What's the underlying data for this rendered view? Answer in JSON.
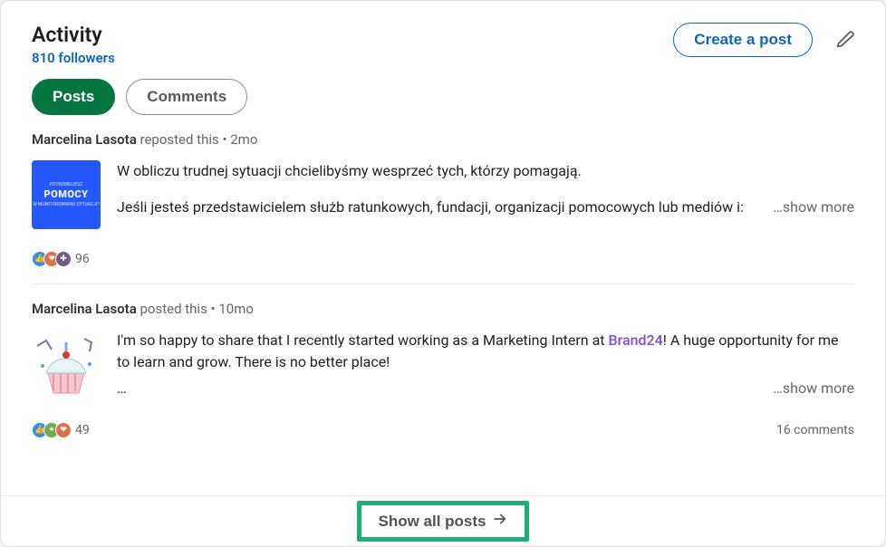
{
  "header": {
    "title": "Activity",
    "followers_text": "810 followers",
    "create_post_label": "Create a post"
  },
  "tabs": {
    "posts": "Posts",
    "comments": "Comments"
  },
  "posts": [
    {
      "author": "Marcelina Lasota",
      "action": "reposted this",
      "time": "2mo",
      "line1": "W obliczu trudnej sytuacji chcielibyśmy wesprzeć tych, którzy pomagają.",
      "line2": "Jeśli jesteś przedstawicielem służb ratunkowych, fundacji, organizacji pomocowych lub mediów i:",
      "show_more": "…show more",
      "reactions_count": "96",
      "thumb_mid": "POMOCY"
    },
    {
      "author": "Marcelina Lasota",
      "action": "posted this",
      "time": "10mo",
      "text_before_brand": "I'm so happy to share that I recently started working as a Marketing Intern at ",
      "brand": "Brand24",
      "text_after_brand": "! A huge opportunity for me to learn and grow. There is no better place!",
      "ellipsis": "…",
      "show_more": "…show more",
      "reactions_count": "49",
      "comments_count": "16 comments"
    }
  ],
  "footer": {
    "show_all": "Show all posts"
  }
}
